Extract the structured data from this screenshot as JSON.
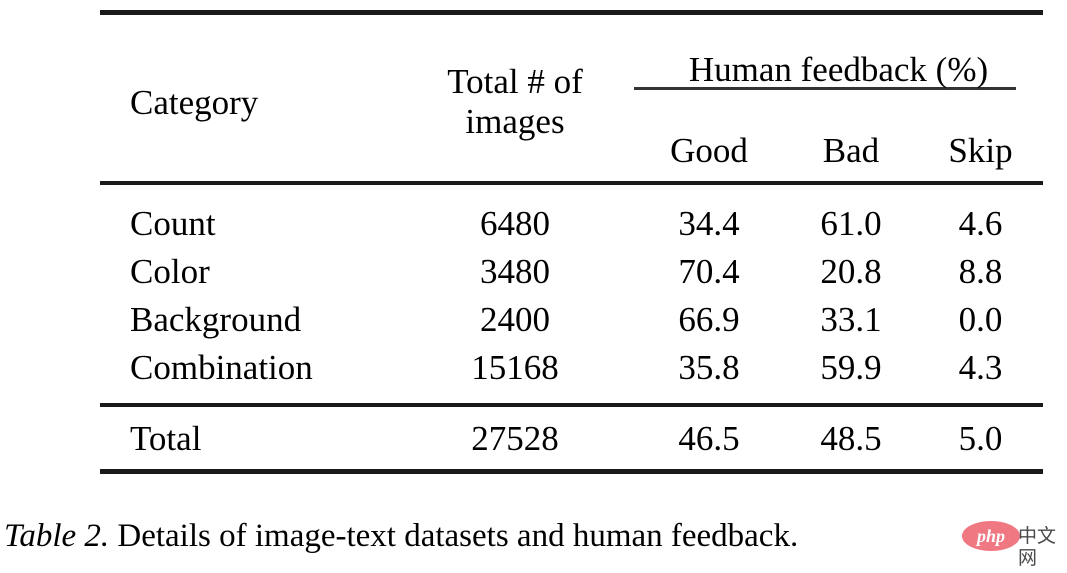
{
  "table": {
    "columns": {
      "category": "Category",
      "total_images": "Total # of\nimages",
      "total_images_line1": "Total # of",
      "total_images_line2": "images",
      "group_header": "Human feedback (%)",
      "good": "Good",
      "bad": "Bad",
      "skip": "Skip"
    },
    "rows": [
      {
        "category": "Count",
        "total": "6480",
        "good": "34.4",
        "bad": "61.0",
        "skip": "4.6"
      },
      {
        "category": "Color",
        "total": "3480",
        "good": "70.4",
        "bad": "20.8",
        "skip": "8.8"
      },
      {
        "category": "Background",
        "total": "2400",
        "good": "66.9",
        "bad": "33.1",
        "skip": "0.0"
      },
      {
        "category": "Combination",
        "total": "15168",
        "good": "35.8",
        "bad": "59.9",
        "skip": "4.3"
      }
    ],
    "total_row": {
      "category": "Total",
      "total": "27528",
      "good": "46.5",
      "bad": "48.5",
      "skip": "5.0"
    }
  },
  "caption": {
    "label": "Table 2.",
    "text": " Details of image-text datasets and human feedback."
  },
  "watermark": {
    "logo_text": "php",
    "site_text": "中文网",
    "logo_color": "#eb5a66"
  },
  "chart_data": {
    "type": "table",
    "title": "Table 2. Details of image-text datasets and human feedback.",
    "columns": [
      "Category",
      "Total # of images",
      "Good",
      "Bad",
      "Skip"
    ],
    "column_groups": [
      {
        "label": "Human feedback (%)",
        "spans": [
          "Good",
          "Bad",
          "Skip"
        ]
      }
    ],
    "rows": [
      [
        "Count",
        6480,
        34.4,
        61.0,
        4.6
      ],
      [
        "Color",
        3480,
        70.4,
        20.8,
        8.8
      ],
      [
        "Background",
        2400,
        66.9,
        33.1,
        0.0
      ],
      [
        "Combination",
        15168,
        35.8,
        59.9,
        4.3
      ],
      [
        "Total",
        27528,
        46.5,
        48.5,
        5.0
      ]
    ]
  }
}
